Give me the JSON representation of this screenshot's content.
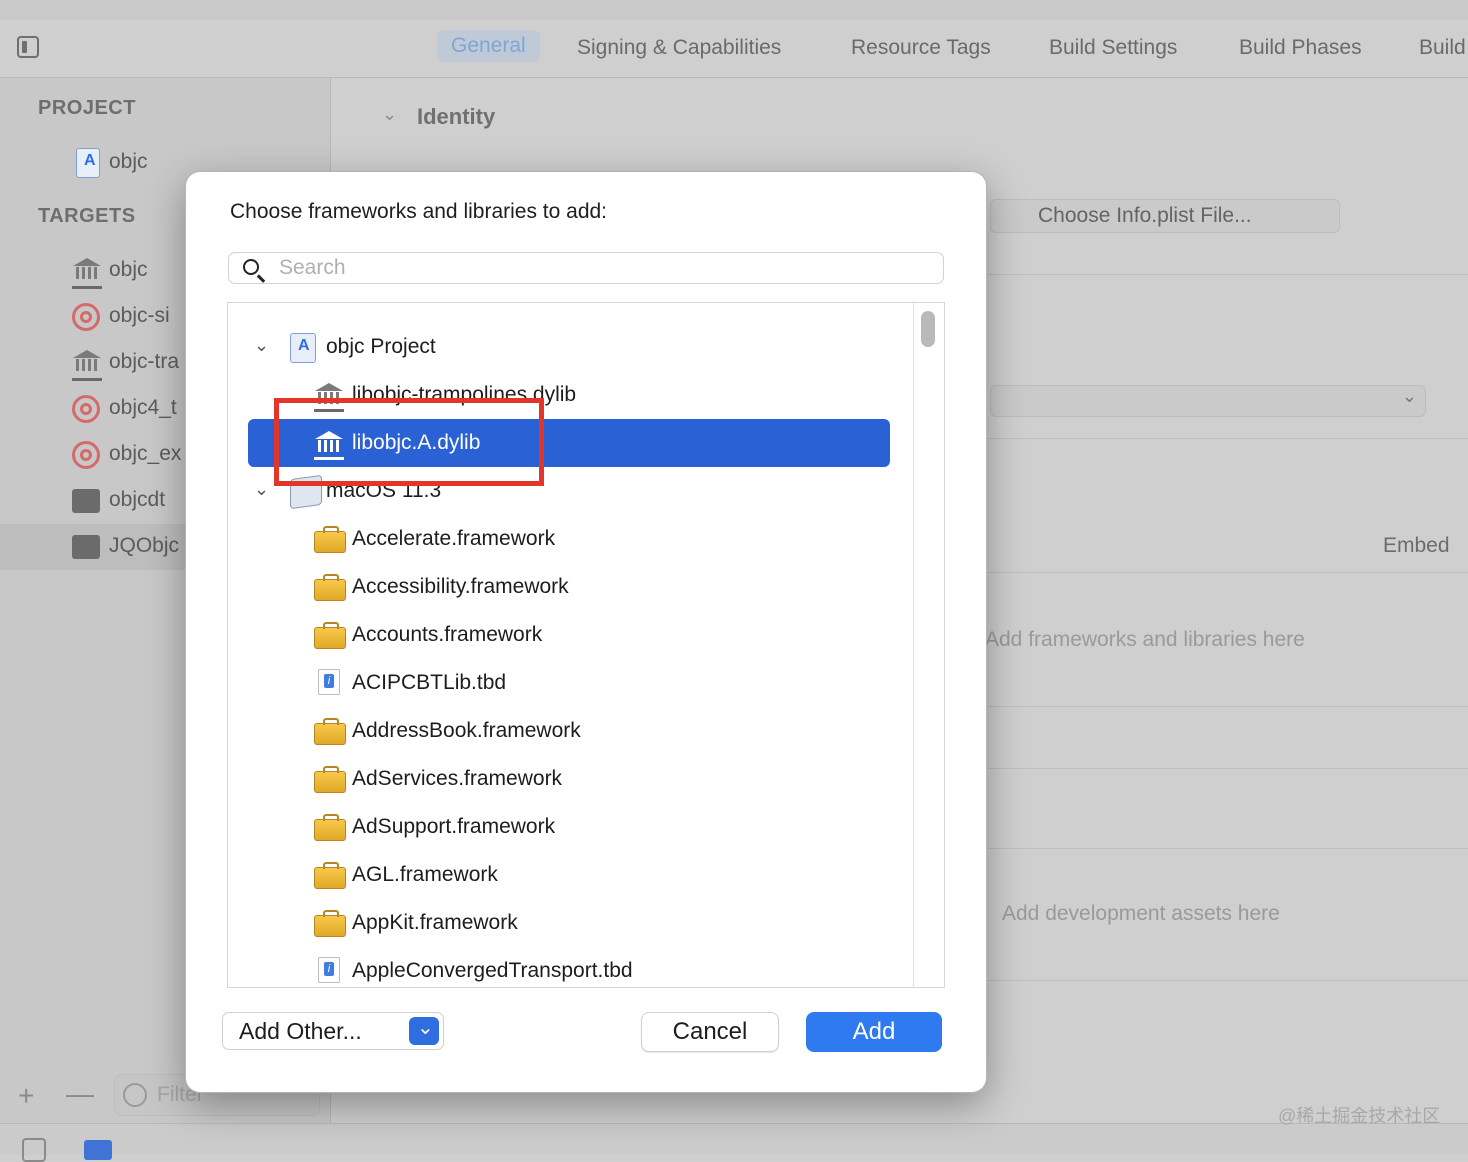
{
  "tabs": [
    {
      "label": "General",
      "active": true
    },
    {
      "label": "Signing & Capabilities"
    },
    {
      "label": "Resource Tags"
    },
    {
      "label": "Build Settings"
    },
    {
      "label": "Build Phases"
    },
    {
      "label": "Build"
    }
  ],
  "sidebar": {
    "project_header": "PROJECT",
    "project_item": "objc",
    "targets_header": "TARGETS",
    "targets": [
      {
        "label": "objc",
        "icon": "library-icon"
      },
      {
        "label": "objc-si",
        "icon": "target-icon"
      },
      {
        "label": "objc-tra",
        "icon": "library-icon"
      },
      {
        "label": "objc4_t",
        "icon": "target-icon"
      },
      {
        "label": "objc_ex",
        "icon": "target-icon"
      },
      {
        "label": "objcdt",
        "icon": "terminal-icon"
      },
      {
        "label": "JQObjc",
        "icon": "terminal-icon",
        "selected": true
      }
    ],
    "filter_placeholder": "Filter"
  },
  "main": {
    "identity": "Identity",
    "choose_plist": "Choose Info.plist File...",
    "embed": "Embed",
    "add_frameworks_hint": "Add frameworks and libraries here",
    "add_assets_hint": "Add development assets here"
  },
  "dialog": {
    "title": "Choose frameworks and libraries to add:",
    "search_placeholder": "Search",
    "items": [
      {
        "label": "objc Project",
        "type": "project",
        "level": 0
      },
      {
        "label": "libobjc-trampolines.dylib",
        "type": "dylib",
        "level": 1
      },
      {
        "label": "libobjc.A.dylib",
        "type": "dylib",
        "level": 1,
        "selected": true
      },
      {
        "label": "macOS 11.3",
        "type": "sdk",
        "level": 0
      },
      {
        "label": "Accelerate.framework",
        "type": "framework",
        "level": 1
      },
      {
        "label": "Accessibility.framework",
        "type": "framework",
        "level": 1
      },
      {
        "label": "Accounts.framework",
        "type": "framework",
        "level": 1
      },
      {
        "label": "ACIPCBTLib.tbd",
        "type": "tbd",
        "level": 1
      },
      {
        "label": "AddressBook.framework",
        "type": "framework",
        "level": 1
      },
      {
        "label": "AdServices.framework",
        "type": "framework",
        "level": 1
      },
      {
        "label": "AdSupport.framework",
        "type": "framework",
        "level": 1
      },
      {
        "label": "AGL.framework",
        "type": "framework",
        "level": 1
      },
      {
        "label": "AppKit.framework",
        "type": "framework",
        "level": 1
      },
      {
        "label": "AppleConvergedTransport.tbd",
        "type": "tbd",
        "level": 1
      }
    ],
    "add_other_label": "Add Other...",
    "cancel_label": "Cancel",
    "add_label": "Add"
  },
  "watermark": "@稀土掘金技术社区",
  "colors": {
    "accent": "#2a62d6",
    "highlight_box": "#e2362b"
  }
}
